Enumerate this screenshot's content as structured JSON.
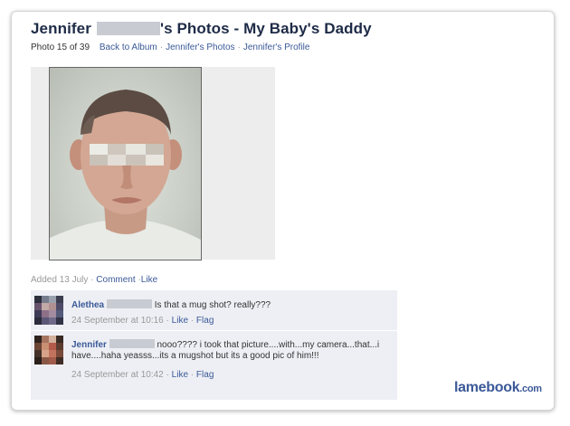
{
  "header": {
    "title_first": "Jennifer",
    "title_rest": "'s Photos - My Baby's Daddy",
    "photo_count": "Photo 15 of 39",
    "links": [
      "Back to Album",
      "Jennifer's Photos",
      "Jennifer's Profile"
    ]
  },
  "photo_info": {
    "added": "Added 13 July",
    "comment_link": "Comment",
    "like_link": "Like"
  },
  "comments": [
    {
      "name": "Alethea",
      "text": "Is that a mug shot? really???",
      "time": "24 September at 10:16",
      "like": "Like",
      "flag": "Flag"
    },
    {
      "name": "Jennifer",
      "text": "nooo???? i took that picture....with...my camera...that...i have....haha yeasss...its a mugshot but its a good pic of him!!!",
      "time": "24 September at 10:42",
      "like": "Like",
      "flag": "Flag"
    }
  ],
  "watermark": {
    "main": "lamebook",
    "suffix": ".com"
  }
}
